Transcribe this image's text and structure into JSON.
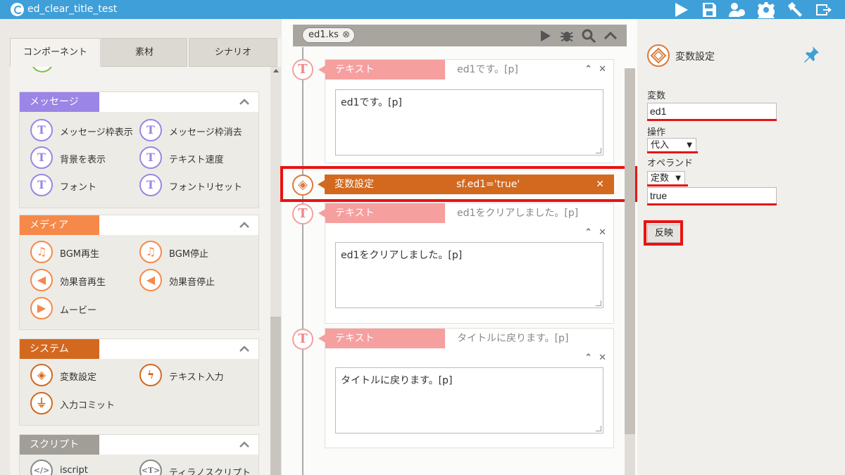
{
  "window": {
    "title": "ed_clear_title_test"
  },
  "toolbar": {
    "icons": [
      "play-icon",
      "save-icon",
      "users-gear-icon",
      "gear-icon",
      "hammer-icon",
      "export-icon"
    ]
  },
  "left_tabs": [
    "コンポーネント",
    "素材",
    "シナリオ"
  ],
  "categories": {
    "message": {
      "label": "メッセージ",
      "color": "#9b85e6",
      "items": [
        "メッセージ枠表示",
        "メッセージ枠消去",
        "背景を表示",
        "テキスト速度",
        "フォント",
        "フォントリセット"
      ]
    },
    "media": {
      "label": "メディア",
      "color": "#f5894a",
      "items": [
        "BGM再生",
        "BGM停止",
        "効果音再生",
        "効果音停止",
        "ムービー"
      ]
    },
    "system": {
      "label": "システム",
      "color": "#d3691f",
      "items": [
        "変数設定",
        "テキスト入力",
        "入力コミット"
      ]
    },
    "script": {
      "label": "スクリプト",
      "color": "#a19d97",
      "items": [
        "iscript",
        "ティラノスクリプト"
      ]
    }
  },
  "editor": {
    "file_tab": "ed1.ks",
    "cards": [
      {
        "label": "テキスト",
        "summary": "ed1です。[p]",
        "text": "ed1です。[p]"
      },
      {
        "label": "テキスト",
        "summary": "ed1をクリアしました。[p]",
        "text": "ed1をクリアしました。[p]"
      },
      {
        "label": "テキスト",
        "summary": "タイトルに戻ります。[p]",
        "text": "タイトルに戻ります。[p]"
      }
    ],
    "var_card": {
      "label": "変数設定",
      "summary": "sf.ed1='true'"
    }
  },
  "props": {
    "title": "変数設定",
    "var_label": "変数",
    "var_value": "ed1",
    "op_label": "操作",
    "op_value": "代入",
    "operand_label": "オペランド",
    "operand_type": "定数",
    "operand_value": "true",
    "apply_label": "反映"
  }
}
